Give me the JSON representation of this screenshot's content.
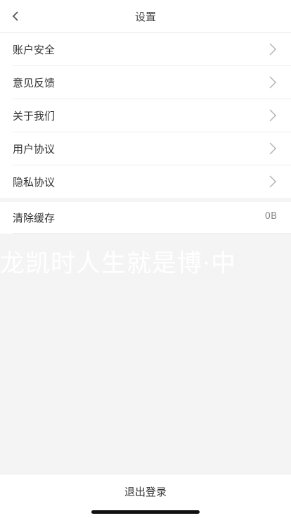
{
  "header": {
    "title": "设置"
  },
  "menu": [
    {
      "label": "账户安全"
    },
    {
      "label": "意见反馈"
    },
    {
      "label": "关于我们"
    },
    {
      "label": "用户协议"
    },
    {
      "label": "隐私协议"
    }
  ],
  "cache": {
    "label": "清除缓存",
    "value": "0B"
  },
  "watermark": "龙凯时人生就是博·中",
  "footer": {
    "logout_label": "退出登录"
  }
}
